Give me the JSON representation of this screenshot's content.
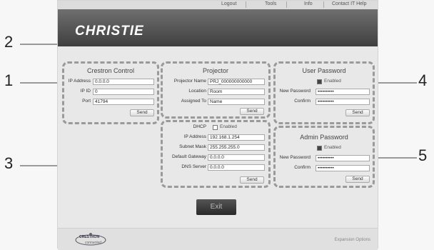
{
  "nav": {
    "links": [
      "Logout",
      "Tools",
      "Info",
      "Contact IT Help"
    ]
  },
  "header": {
    "logo": "CHRISTIE"
  },
  "callouts": [
    "1",
    "2",
    "3",
    "4",
    "5"
  ],
  "crestron": {
    "title": "Crestron Control",
    "ip_label": "IP Address",
    "ip_value": "0.0.0.0",
    "ipid_label": "IP ID",
    "ipid_value": "0",
    "port_label": "Port",
    "port_value": "41794",
    "send": "Send"
  },
  "projector": {
    "title": "Projector",
    "name_label": "Projector Name",
    "name_value": "PRJ_000000000000",
    "location_label": "Location",
    "location_value": "Room",
    "assigned_label": "Assigned To",
    "assigned_value": "Name",
    "send": "Send"
  },
  "network": {
    "dhcp_label": "DHCP",
    "dhcp_enabled_label": "Enabled",
    "ip_label": "IP Address",
    "ip_value": "192.168.1.254",
    "mask_label": "Subnet Mask",
    "mask_value": "255.255.255.0",
    "gateway_label": "Default Gateway",
    "gateway_value": "0.0.0.0",
    "dns_label": "DNS Server",
    "dns_value": "0.0.0.0",
    "send": "Send"
  },
  "user_password": {
    "title": "User Password",
    "enabled_label": "Enabled",
    "new_label": "New Password",
    "new_value": "••••••••••",
    "confirm_label": "Confirm",
    "confirm_value": "••••••••••",
    "send": "Send"
  },
  "admin_password": {
    "title": "Admin Password",
    "enabled_label": "Enabled",
    "new_label": "New Password",
    "new_value": "••••••••••",
    "confirm_label": "Confirm",
    "confirm_value": "••••••••••",
    "send": "Send"
  },
  "exit": "Exit",
  "footer": {
    "brand": "CRESTRON",
    "brand_sub": "connected",
    "expansion": "Expansion Options"
  }
}
